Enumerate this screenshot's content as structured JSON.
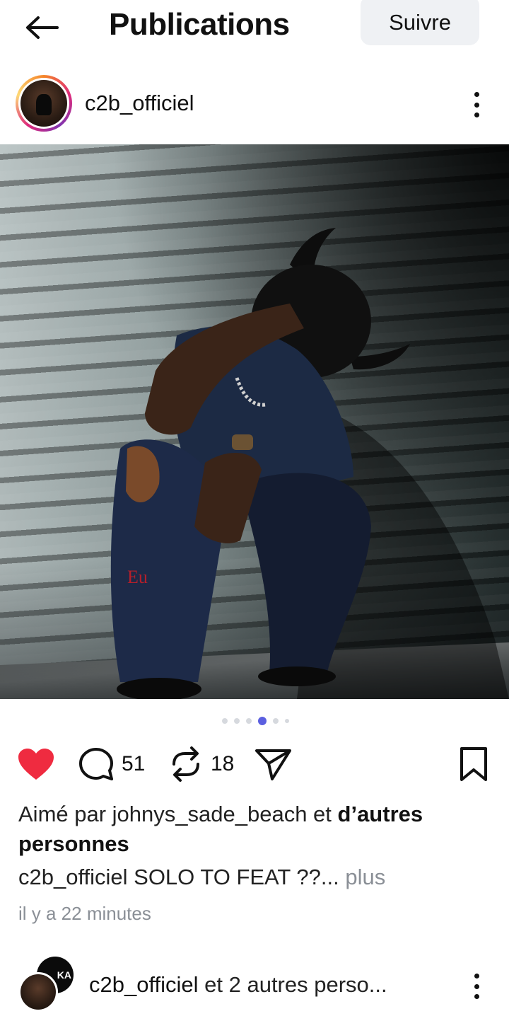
{
  "header": {
    "back_icon": "arrow-left-icon",
    "title": "Publications",
    "follow_label": "Suivre"
  },
  "post": {
    "username": "c2b_officiel",
    "menu_icon": "more-vertical-icon",
    "carousel": {
      "count": 6,
      "active_index": 3
    },
    "actions": {
      "like_icon": "heart-filled-icon",
      "like_color": "#ef2b40",
      "comment_icon": "comment-icon",
      "comment_count": "51",
      "repost_icon": "repost-icon",
      "repost_count": "18",
      "share_icon": "send-icon",
      "save_icon": "bookmark-icon"
    },
    "likes": {
      "prefix": "Aimé par johnys_sade_beach et ",
      "bold": "d’autres personnes"
    },
    "caption": {
      "username": "c2b_officiel",
      "text": " SOLO TO FEAT ??...",
      "more": " plus"
    },
    "time": "il y a 22 minutes"
  },
  "next_post": {
    "avatar_text": "KA",
    "username": "c2b_officiel",
    "rest": " et 2 autres perso..."
  },
  "colors": {
    "accent": "#5b5fe0",
    "like": "#ef2b40",
    "muted": "#8a8f96",
    "follow_bg": "#eff1f4"
  }
}
